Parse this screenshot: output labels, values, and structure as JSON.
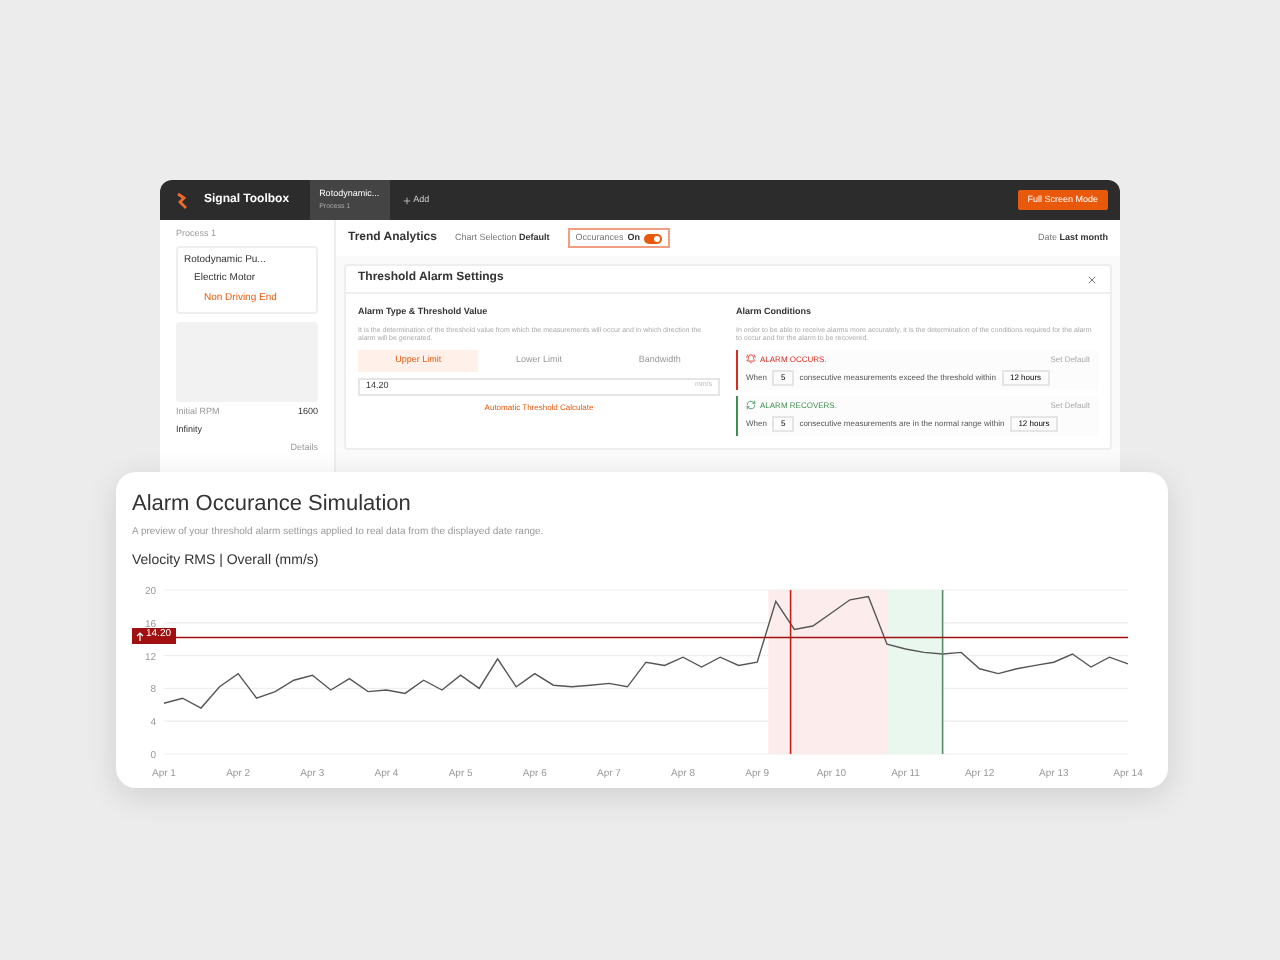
{
  "app": {
    "brand": "Signal Toolbox",
    "tabs": [
      {
        "label": "Rotodynamic...",
        "sublabel": "Process 1",
        "selected": true
      }
    ],
    "add": "Add",
    "fullscreen": "Full Screen Mode"
  },
  "sidebar": {
    "process": "Process 1",
    "tree": [
      {
        "label": "Rotodynamic Pu...",
        "selected": false,
        "children": [
          {
            "label": "Electric Motor",
            "selected": false,
            "children": [
              {
                "label": "Non Driving End",
                "selected": true
              }
            ]
          }
        ]
      }
    ],
    "rpm_label": "Initial RPM",
    "rpm": "1600",
    "status": "Infinity",
    "details": "Details"
  },
  "toolbar": {
    "title": "Trend Analytics",
    "chart_selection": {
      "label": "Chart Selection",
      "value": "Default"
    },
    "occurrences": {
      "label": "Occurances",
      "value": "On",
      "on": true
    },
    "date": {
      "label": "Date",
      "value": "Last month"
    }
  },
  "dialog": {
    "title": "Threshold Alarm Settings",
    "left": {
      "heading": "Alarm Type & Threshold Value",
      "desc": "It is the determination of the threshold value from which the measurements will occur and in which direction the alarm will be generated.",
      "types": [
        {
          "label": "Upper Limit",
          "selected": true
        },
        {
          "label": "Lower Limit",
          "selected": false
        },
        {
          "label": "Bandwidth",
          "selected": false
        }
      ],
      "value": "14.20",
      "unit": "mm/s",
      "auto": "Automatic Threshold Calculate"
    },
    "right": {
      "heading": "Alarm Conditions",
      "desc": "In order to be able to receive alarms more accurately, it is the determination of the conditions required for the alarm to occur and for the alarm to be recovered.",
      "conditions": [
        {
          "kind": "occurs",
          "title": "ALARM OCCURS.",
          "color": "#d92d20",
          "set_default": "Set Default",
          "when": "When",
          "count": "5",
          "text": "consecutive measurements exceed the threshold within",
          "window": "12 hours"
        },
        {
          "kind": "recovers",
          "title": "ALARM RECOVERS.",
          "color": "#3f8f4f",
          "set_default": "Set Default",
          "when": "When",
          "count": "5",
          "text": "consecutive measurements are in the normal range within",
          "window": "12 hours"
        }
      ]
    }
  },
  "simulation": {
    "title": "Alarm Occurance Simulation",
    "subtitle": "A preview of your threshold alarm settings applied to real data from the displayed date range.",
    "series_label": "Velocity RMS | Overall (mm/s)",
    "chart_data": {
      "type": "line",
      "categories": [
        "Apr 1",
        null,
        null,
        null,
        "Apr 2",
        null,
        null,
        null,
        "Apr 3",
        null,
        null,
        null,
        "Apr 4",
        null,
        null,
        null,
        "Apr 5",
        null,
        null,
        null,
        "Apr 6",
        null,
        null,
        null,
        "Apr 7",
        null,
        null,
        null,
        "Apr 8",
        null,
        null,
        null,
        "Apr 9",
        null,
        null,
        null,
        "Apr 10",
        null,
        null,
        null,
        "Apr 11",
        null,
        null,
        null,
        "Apr 12",
        null,
        null,
        null,
        "Apr 13",
        null,
        null,
        null,
        "Apr 14"
      ],
      "series": [
        {
          "color": "#555555",
          "values": [
            6.2,
            6.8,
            5.6,
            8.2,
            9.8,
            6.8,
            7.6,
            9.0,
            9.6,
            7.8,
            9.2,
            7.6,
            7.8,
            7.4,
            9.0,
            7.8,
            9.6,
            8.0,
            11.6,
            8.2,
            9.8,
            8.4,
            8.2,
            8.4,
            8.6,
            8.2,
            11.2,
            10.8,
            11.8,
            10.6,
            11.8,
            10.8,
            11.2,
            18.6,
            15.2,
            15.6,
            17.2,
            18.8,
            19.2,
            13.4,
            12.8,
            12.4,
            12.2,
            12.4,
            10.4,
            9.8,
            10.4,
            10.8,
            11.2,
            12.2,
            10.6,
            11.8,
            11.0
          ]
        }
      ],
      "ylim": [
        0,
        20
      ],
      "yticks": [
        0,
        4,
        8,
        12,
        16,
        20
      ],
      "grid": true,
      "ref_lines": [
        {
          "axis": "y",
          "value": 14.2,
          "label": "14.20",
          "color": "#a01010"
        }
      ]
    }
  }
}
